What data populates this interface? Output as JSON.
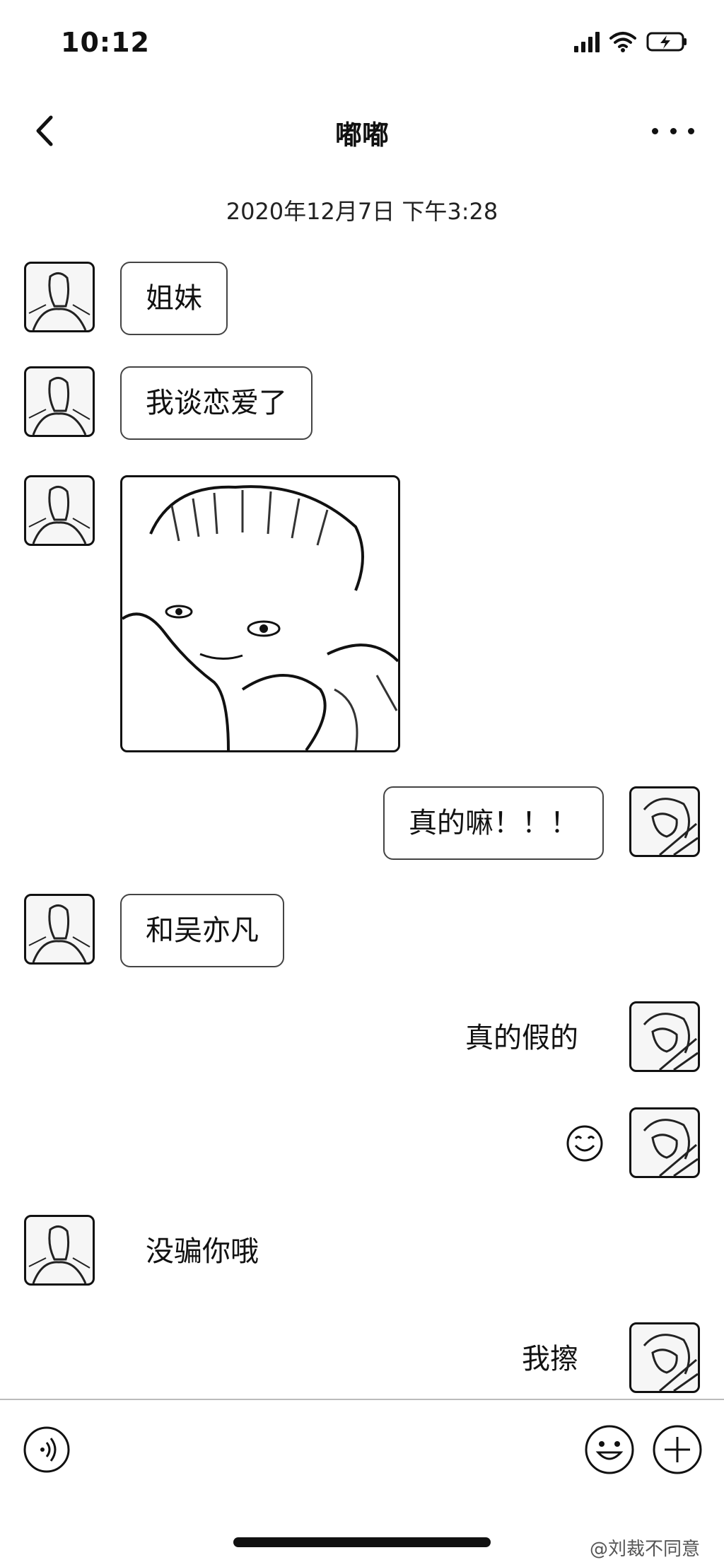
{
  "status": {
    "time": "10:12"
  },
  "header": {
    "title": "嘟嘟"
  },
  "timestamp": "2020年12月7日 下午3:28",
  "messages": [
    {
      "side": "left",
      "type": "text",
      "text": "姐妹"
    },
    {
      "side": "left",
      "type": "text",
      "text": "我谈恋爱了"
    },
    {
      "side": "left",
      "type": "image",
      "image": "baby-photo"
    },
    {
      "side": "right",
      "type": "text",
      "text": "真的嘛！！！"
    },
    {
      "side": "left",
      "type": "text",
      "text": "和吴亦凡"
    },
    {
      "side": "right",
      "type": "text",
      "text": "真的假的"
    },
    {
      "side": "right",
      "type": "emoji",
      "icon": "smile-emoji-icon"
    },
    {
      "side": "left",
      "type": "text",
      "text": "没骗你哦"
    },
    {
      "side": "right",
      "type": "text",
      "text": "我擦"
    }
  ],
  "toolbar": {
    "voice_icon": "voice-icon",
    "emoji_icon": "emoji-icon",
    "plus_icon": "plus-icon"
  },
  "watermark": "@刘裁不同意"
}
